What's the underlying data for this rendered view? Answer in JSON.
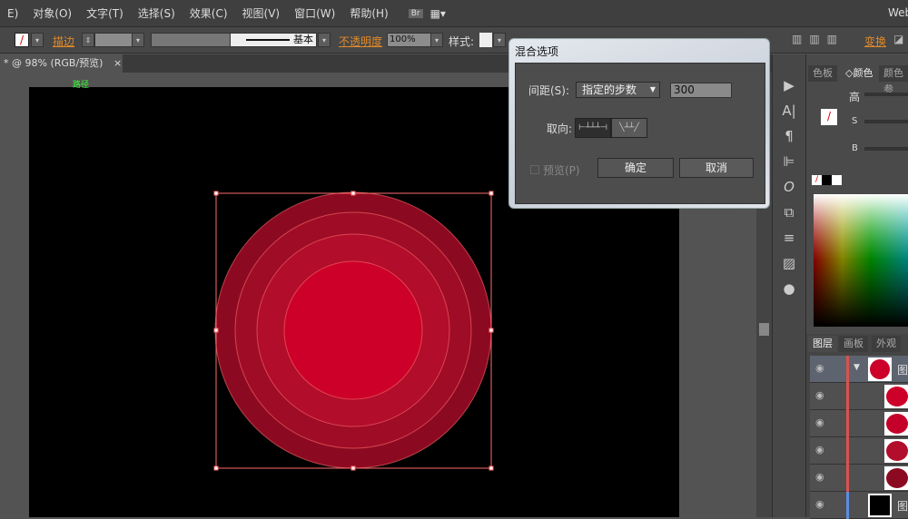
{
  "menu": [
    "E)",
    "对象(O)",
    "文字(T)",
    "选择(S)",
    "效果(C)",
    "视图(V)",
    "窗口(W)",
    "帮助(H)"
  ],
  "workspace": "Web",
  "control": {
    "stroke_label": "描边",
    "stroke_style": "基本",
    "opacity_label": "不透明度",
    "opacity_value": "100%",
    "style_label": "样式:",
    "transform_label": "变换"
  },
  "document_tab": {
    "title": "* @ 98% (RGB/预览)",
    "close": "×"
  },
  "path_hint": "路径",
  "dialog": {
    "title": "混合选项",
    "spacing_label": "间距(S):",
    "spacing_value": "指定的步数",
    "steps_value": "300",
    "orientation_label": "取向:",
    "preview_label": "预览(P)",
    "preview_checked": false,
    "ok": "确定",
    "cancel": "取消"
  },
  "color_panel": {
    "tabs": [
      "色板",
      "◇颜色",
      "颜色参"
    ],
    "sliders": [
      "高",
      "S",
      "B"
    ]
  },
  "layers_panel": {
    "tabs": [
      "图层",
      "画板",
      "外观"
    ],
    "top_layer_label": "图",
    "bottom_layer_label": "图"
  },
  "colors": {
    "ring1": "#8c0a21",
    "ring2": "#9e0c26",
    "ring3": "#b20d2b",
    "center": "#cc0029",
    "selection": "#ff6d6d",
    "layer_bar": "#d9534f"
  }
}
